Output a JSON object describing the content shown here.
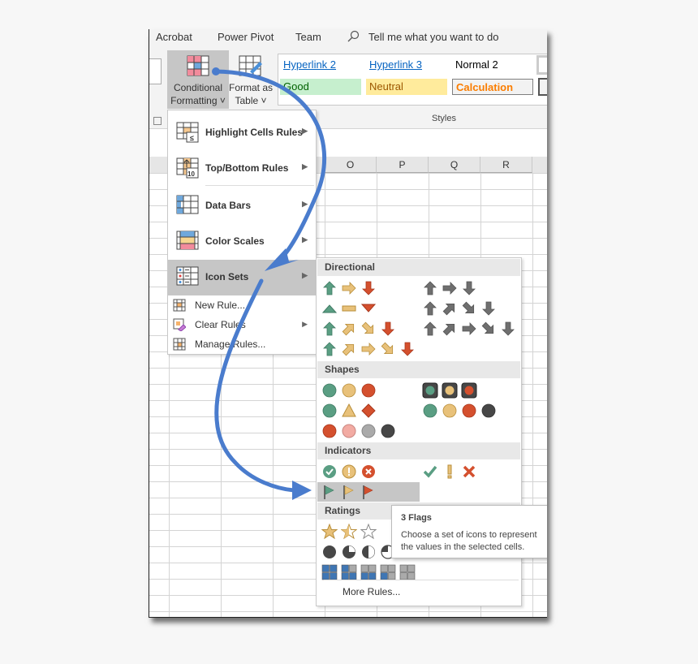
{
  "ribbon": {
    "tabs": [
      "Acrobat",
      "Power Pivot",
      "Team"
    ],
    "tell_me": "Tell me what you want to do",
    "conditional_formatting": {
      "line1": "Conditional",
      "line2": "Formatting ˅"
    },
    "format_as_table": {
      "line1": "Format as",
      "line2": "Table ˅"
    },
    "styles_group_label": "Styles",
    "styles": [
      {
        "name": "Hyperlink 2",
        "bg": "#ffffff",
        "fg": "#0563c1"
      },
      {
        "name": "Hyperlink 3",
        "bg": "#ffffff",
        "fg": "#0563c1"
      },
      {
        "name": "Normal 2",
        "bg": "#ffffff",
        "fg": "#000000"
      },
      {
        "name": "Good",
        "bg": "#c6efce",
        "fg": "#006100"
      },
      {
        "name": "Neutral",
        "bg": "#ffeb9c",
        "fg": "#9c5700"
      },
      {
        "name": "Calculation",
        "bg": "#f2f2f2",
        "fg": "#fa7d00"
      }
    ]
  },
  "grid": {
    "columns": [
      "O",
      "P",
      "Q",
      "R"
    ]
  },
  "menu": {
    "items": [
      {
        "label": "Highlight Cells Rules",
        "icon": "highlight-cells-icon",
        "submenu": true
      },
      {
        "label": "Top/Bottom Rules",
        "icon": "top-bottom-icon",
        "submenu": true
      },
      {
        "label": "Data Bars",
        "icon": "data-bars-icon",
        "submenu": true
      },
      {
        "label": "Color Scales",
        "icon": "color-scales-icon",
        "submenu": true
      },
      {
        "label": "Icon Sets",
        "icon": "icon-sets-icon",
        "submenu": true,
        "selected": true
      }
    ],
    "small_items": [
      {
        "label": "New Rule...",
        "icon": "new-rule-icon",
        "submenu": false
      },
      {
        "label": "Clear Rules",
        "icon": "clear-rules-icon",
        "submenu": true
      },
      {
        "label": "Manage Rules...",
        "icon": "manage-rules-icon",
        "submenu": false
      }
    ]
  },
  "icon_sets": {
    "sections": [
      "Directional",
      "Shapes",
      "Indicators",
      "Ratings"
    ],
    "selected": "3 Flags",
    "more_rules": "More Rules..."
  },
  "colors": {
    "green": "#5a9e83",
    "yellow": "#e8c17a",
    "red": "#d4502e",
    "gray": "#6f6f6f",
    "dark": "#474747",
    "blue": "#3f76b4",
    "accent_arrow": "#4a7ccd"
  },
  "tooltip": {
    "title": "3 Flags",
    "line1": "Choose a set of icons to represent",
    "line2": "the values in the selected cells."
  }
}
